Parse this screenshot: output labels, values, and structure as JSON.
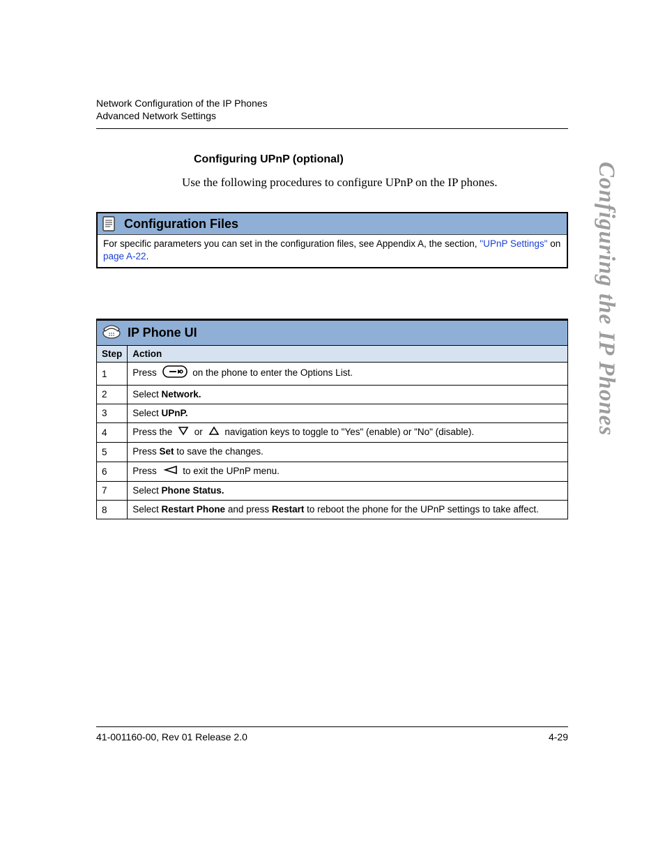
{
  "header": {
    "line1": "Network Configuration of the IP Phones",
    "line2": "Advanced Network Settings"
  },
  "section": {
    "title": "Configuring UPnP (optional)",
    "intro": "Use the following procedures to configure UPnP on the IP phones."
  },
  "config_box": {
    "title": "Configuration Files",
    "body_prefix": "For specific parameters you can set in the configuration files, see Appendix A, the section, ",
    "link1": "\"UPnP Settings\"",
    "body_mid": " on ",
    "link2": "page A-22",
    "body_suffix": "."
  },
  "ui_box": {
    "title": "IP Phone UI",
    "col1": "Step",
    "col2": "Action",
    "steps": [
      {
        "num": "1",
        "type": "press_options",
        "pre": "Press ",
        "post": " on the phone to enter the Options List."
      },
      {
        "num": "2",
        "type": "plain",
        "pre": "Select ",
        "bold": "Network."
      },
      {
        "num": "3",
        "type": "plain",
        "pre": "Select ",
        "bold": "UPnP."
      },
      {
        "num": "4",
        "type": "nav",
        "pre": "Press the ",
        "mid": " or ",
        "post": " navigation keys to toggle to \"Yes\" (enable) or \"No\" (disable)."
      },
      {
        "num": "5",
        "type": "plain",
        "pre": "Press ",
        "bold": "Set",
        "post": " to save the changes."
      },
      {
        "num": "6",
        "type": "press_back",
        "pre": "Press ",
        "post": " to exit the UPnP menu."
      },
      {
        "num": "7",
        "type": "plain",
        "pre": "Select ",
        "bold": "Phone Status."
      },
      {
        "num": "8",
        "type": "restart",
        "pre": "Select ",
        "bold1": "Restart Phone",
        "mid": " and press ",
        "bold2": "Restart",
        "post": " to reboot the phone for the UPnP settings to take affect."
      }
    ]
  },
  "side_tab": "Configuring the IP Phones",
  "footer": {
    "left": "41-001160-00, Rev 01  Release 2.0",
    "right": "4-29"
  },
  "icons": {
    "doc": "document-icon",
    "phone": "phone-icon",
    "options": "options-key-icon",
    "down": "down-arrow-icon",
    "up": "up-arrow-icon",
    "back": "back-arrow-icon"
  }
}
